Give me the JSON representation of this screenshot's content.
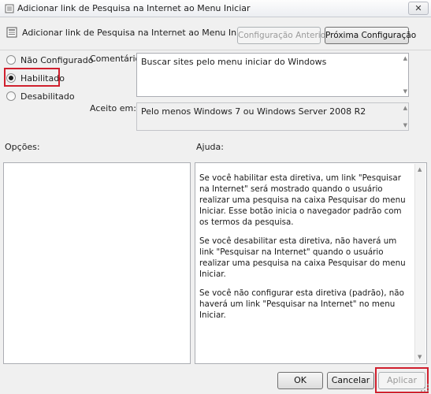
{
  "window": {
    "title": "Adicionar link de Pesquisa na Internet ao Menu Iniciar",
    "close_label": "✕"
  },
  "header": {
    "title": "Adicionar link de Pesquisa na Internet ao Menu Iniciar",
    "prev_button": "Configuração Anterior",
    "next_button": "Próxima Configuração"
  },
  "state": {
    "options": [
      {
        "label": "Não Configurado",
        "checked": false
      },
      {
        "label": "Habilitado",
        "checked": true
      },
      {
        "label": "Desabilitado",
        "checked": false
      }
    ]
  },
  "comment": {
    "label": "Comentário:",
    "value": "Buscar sites pelo menu iniciar do Windows"
  },
  "supported": {
    "label": "Aceito em:",
    "value": "Pelo menos Windows 7 ou Windows Server 2008 R2"
  },
  "options_label": "Opções:",
  "help": {
    "label": "Ajuda:",
    "paragraphs": [
      "Se você habilitar esta diretiva, um link \"Pesquisar na Internet\" será mostrado quando o usuário realizar uma pesquisa na caixa Pesquisar do menu Iniciar. Esse botão inicia o navegador padrão com os termos da pesquisa.",
      "Se você desabilitar esta diretiva, não haverá um link \"Pesquisar na Internet\" quando o usuário realizar uma pesquisa na caixa Pesquisar do menu Iniciar.",
      "Se você não configurar esta diretiva (padrão), não haverá um link \"Pesquisar na Internet\" no menu Iniciar."
    ]
  },
  "footer": {
    "ok": "OK",
    "cancel": "Cancelar",
    "apply": "Aplicar"
  },
  "colors": {
    "highlight": "#d0202e"
  }
}
